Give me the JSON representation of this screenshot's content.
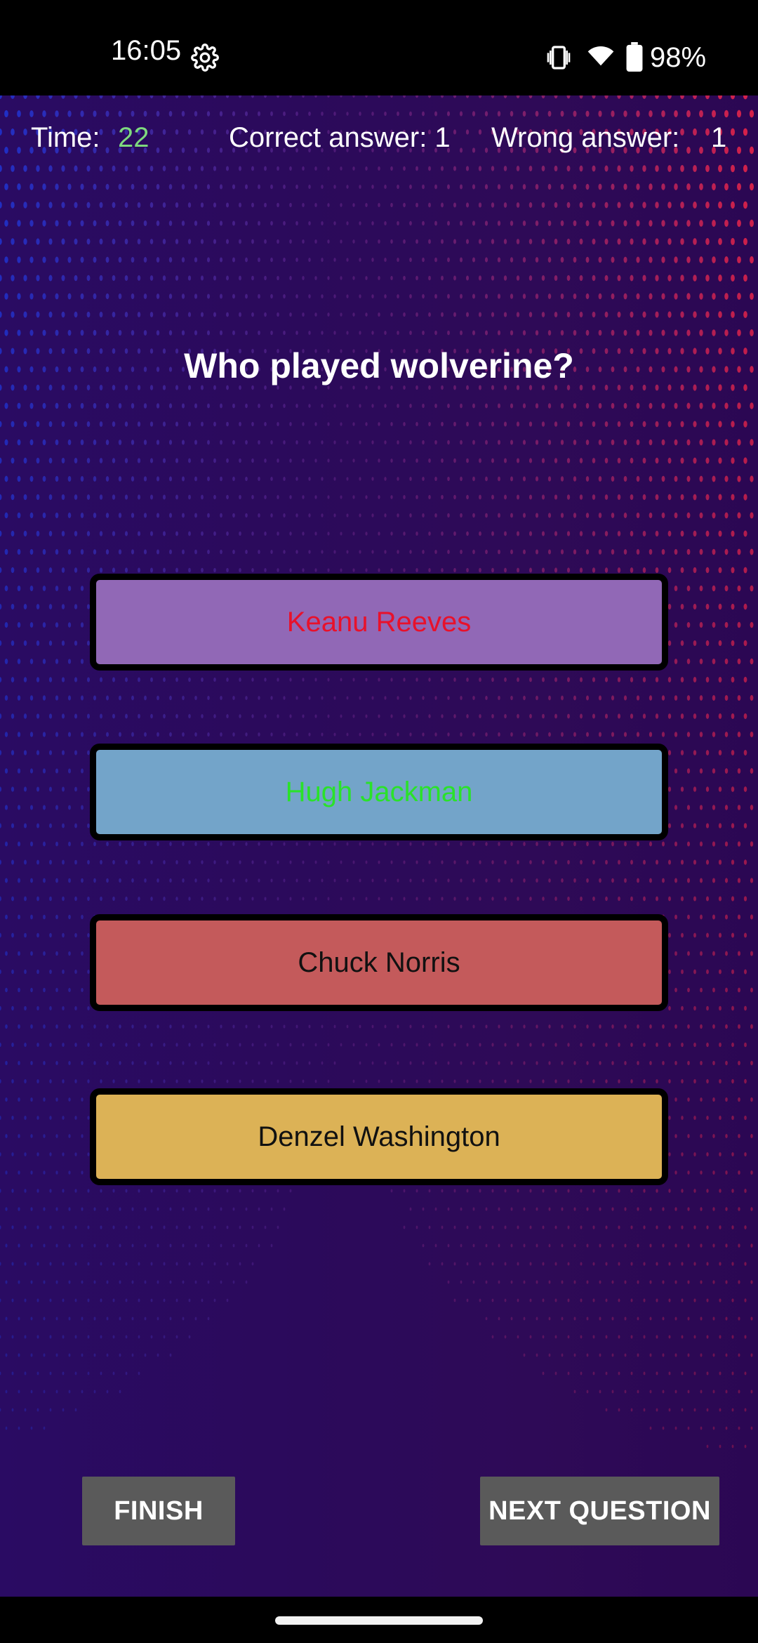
{
  "status_bar": {
    "time": "16:05",
    "battery_percent": "98%",
    "icons": [
      "gear-icon",
      "vibrate-icon",
      "wifi-icon",
      "battery-icon"
    ]
  },
  "hud": {
    "time_label": "Time:",
    "time_value": "22",
    "correct_label": "Correct answer: 1",
    "wrong_label": "Wrong answer:",
    "wrong_value": "1"
  },
  "question": {
    "text": "Who played wolverine?"
  },
  "answers": [
    {
      "label": "Keanu Reeves",
      "state": "wrong"
    },
    {
      "label": "Hugh Jackman",
      "state": "correct"
    },
    {
      "label": "Chuck Norris",
      "state": "neutral"
    },
    {
      "label": "Denzel Washington",
      "state": "neutral"
    }
  ],
  "buttons": {
    "finish": "FINISH",
    "next": "NEXT QUESTION"
  },
  "colors": {
    "time_value": "#7ed97e",
    "answer_1_bg": "#9168b6",
    "answer_2_bg": "#73a4c9",
    "answer_3_bg": "#c45a5b",
    "answer_4_bg": "#dcb256",
    "wrong_text": "#e8112b",
    "correct_text": "#2ae22a"
  }
}
